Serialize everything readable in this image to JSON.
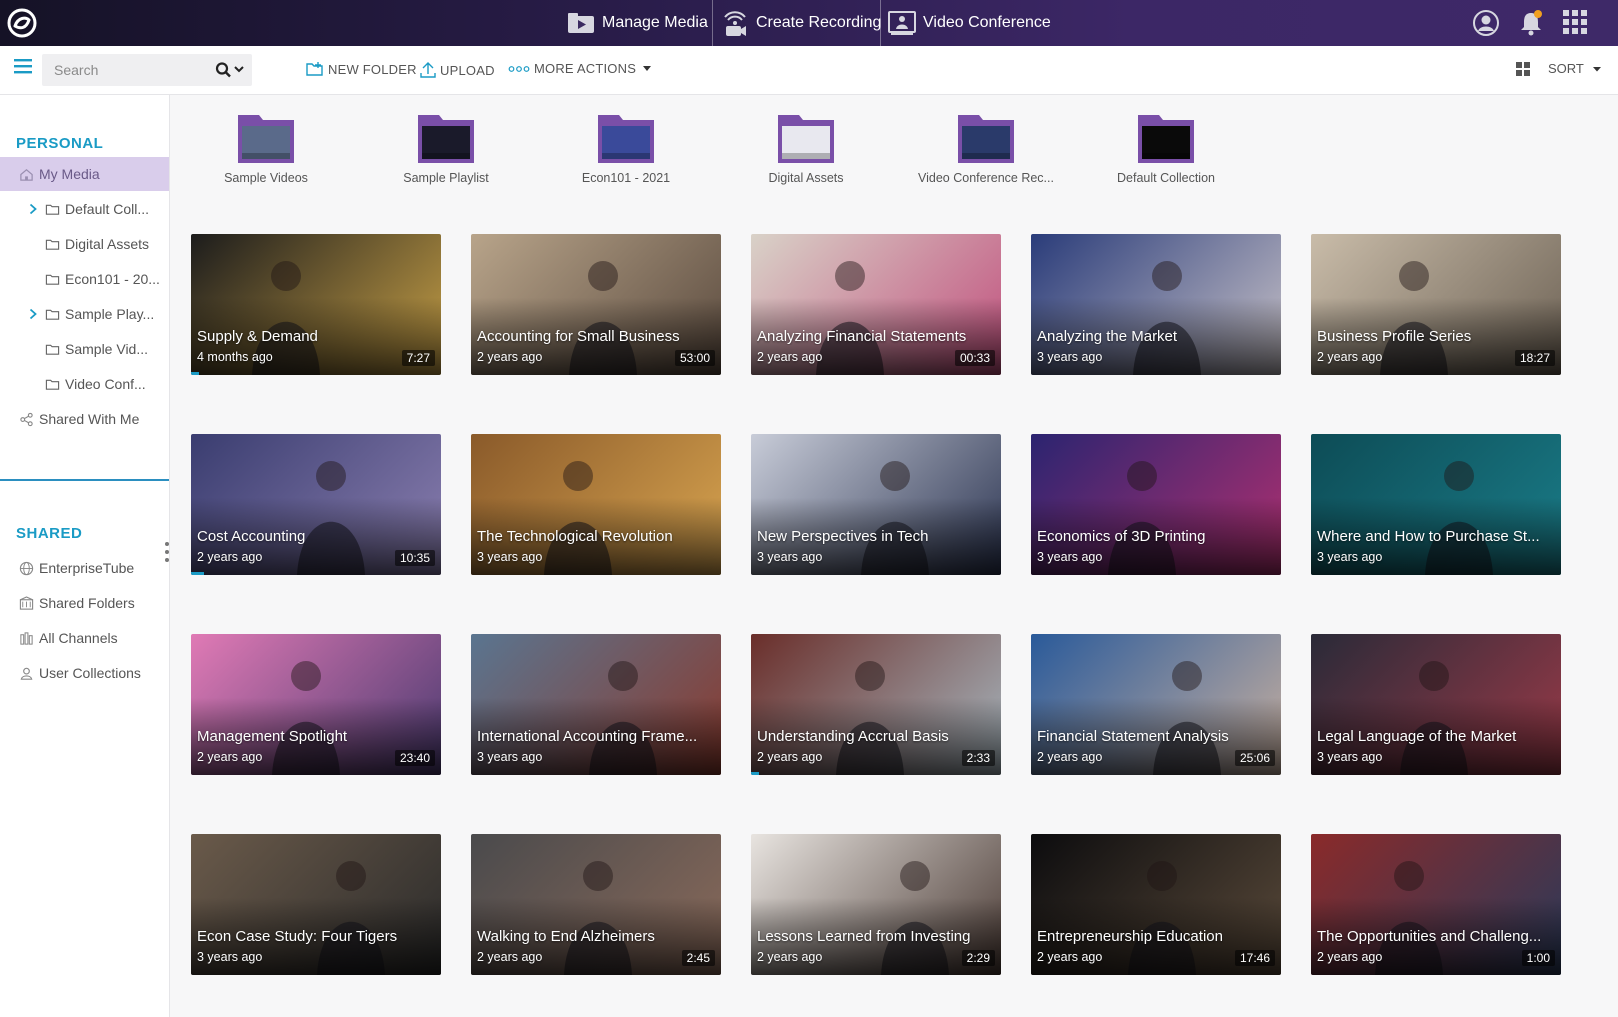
{
  "topbar": {
    "nav": [
      {
        "label": "Manage Media",
        "icon": "manage-media-icon"
      },
      {
        "label": "Create Recording",
        "icon": "create-recording-icon"
      },
      {
        "label": "Video Conference",
        "icon": "video-conference-icon"
      }
    ],
    "right_icons": [
      "user-account-icon",
      "notifications-bell-icon",
      "app-grid-icon"
    ]
  },
  "toolbar": {
    "search_placeholder": "Search",
    "new_folder": "NEW FOLDER",
    "upload": "UPLOAD",
    "more_actions": "MORE ACTIONS",
    "sort": "SORT"
  },
  "sidebar": {
    "personal_heading": "PERSONAL",
    "personal_items": [
      {
        "label": "My Media",
        "icon": "home-icon",
        "active": true,
        "expandable": false
      },
      {
        "label": "Default Coll...",
        "icon": "folder-icon",
        "expandable": true
      },
      {
        "label": "Digital Assets",
        "icon": "folder-icon",
        "expandable": false
      },
      {
        "label": "Econ101 - 20...",
        "icon": "folder-icon",
        "expandable": false
      },
      {
        "label": "Sample Play...",
        "icon": "folder-icon",
        "expandable": true
      },
      {
        "label": "Sample Vid...",
        "icon": "folder-icon",
        "expandable": false
      },
      {
        "label": "Video Conf...",
        "icon": "folder-icon",
        "expandable": false
      },
      {
        "label": "Shared With Me",
        "icon": "share-icon",
        "expandable": false
      }
    ],
    "shared_heading": "SHARED",
    "shared_items": [
      {
        "label": "EnterpriseTube",
        "icon": "globe-icon"
      },
      {
        "label": "Shared Folders",
        "icon": "shared-folders-icon"
      },
      {
        "label": "All Channels",
        "icon": "channels-icon"
      },
      {
        "label": "User Collections",
        "icon": "user-collections-icon"
      }
    ]
  },
  "folders": [
    {
      "label": "Sample Videos"
    },
    {
      "label": "Sample Playlist"
    },
    {
      "label": "Econ101 - 2021"
    },
    {
      "label": "Digital Assets"
    },
    {
      "label": "Video Conference Rec..."
    },
    {
      "label": "Default Collection"
    }
  ],
  "videos": [
    {
      "title": "Supply & Demand",
      "age": "4 months ago",
      "duration": "7:27",
      "progress": 0.03,
      "colors": [
        "#1c1c1c",
        "#c7a046"
      ]
    },
    {
      "title": "Accounting for Small Business",
      "age": "2 years ago",
      "duration": "53:00",
      "progress": 0,
      "colors": [
        "#b8a48a",
        "#5a4a3e"
      ]
    },
    {
      "title": "Analyzing Financial Statements",
      "age": "2 years ago",
      "duration": "00:33",
      "progress": 0,
      "colors": [
        "#d9d2c8",
        "#c14f7d"
      ]
    },
    {
      "title": "Analyzing the Market",
      "age": "3 years ago",
      "duration": "",
      "progress": 0,
      "colors": [
        "#2a3c7a",
        "#c8c2c8"
      ]
    },
    {
      "title": "Business Profile Series",
      "age": "2 years ago",
      "duration": "18:27",
      "progress": 0,
      "colors": [
        "#c9bca9",
        "#6c6154"
      ]
    },
    {
      "title": "Cost Accounting",
      "age": "2 years ago",
      "duration": "10:35",
      "progress": 0.05,
      "colors": [
        "#3a3d70",
        "#8b7fb0"
      ]
    },
    {
      "title": "The Technological Revolution",
      "age": "3 years ago",
      "duration": "",
      "progress": 0,
      "colors": [
        "#8a5a2a",
        "#d9a550"
      ]
    },
    {
      "title": "New Perspectives in Tech",
      "age": "3 years ago",
      "duration": "",
      "progress": 0,
      "colors": [
        "#c8ccd8",
        "#2c3552"
      ]
    },
    {
      "title": "Economics of 3D Printing",
      "age": "3 years ago",
      "duration": "",
      "progress": 0,
      "colors": [
        "#2b2470",
        "#b03070"
      ]
    },
    {
      "title": "Where and How to Purchase St...",
      "age": "3 years ago",
      "duration": "",
      "progress": 0,
      "colors": [
        "#0d4c56",
        "#1a7c88"
      ]
    },
    {
      "title": "Management Spotlight",
      "age": "2 years ago",
      "duration": "23:40",
      "progress": 0,
      "colors": [
        "#e07ab5",
        "#4a3a70"
      ]
    },
    {
      "title": "International Accounting Frame...",
      "age": "3 years ago",
      "duration": "",
      "progress": 0,
      "colors": [
        "#5a7590",
        "#8a3a2e"
      ]
    },
    {
      "title": "Understanding Accrual Basis",
      "age": "2 years ago",
      "duration": "2:33",
      "progress": 0.03,
      "colors": [
        "#6a2e2a",
        "#a8b8c0"
      ]
    },
    {
      "title": "Financial Statement Analysis",
      "age": "2 years ago",
      "duration": "25:06",
      "progress": 0,
      "colors": [
        "#2a5a9a",
        "#c8b0a0"
      ]
    },
    {
      "title": "Legal Language of the Market",
      "age": "3 years ago",
      "duration": "",
      "progress": 0,
      "colors": [
        "#2a2a38",
        "#9a3a48"
      ]
    },
    {
      "title": "Econ Case Study: Four Tigers",
      "age": "3 years ago",
      "duration": "",
      "progress": 0,
      "colors": [
        "#6a5a4a",
        "#2a2a2a"
      ]
    },
    {
      "title": "Walking to End Alzheimers",
      "age": "2 years ago",
      "duration": "2:45",
      "progress": 0,
      "colors": [
        "#4a4a4c",
        "#8a6a5a"
      ]
    },
    {
      "title": "Lessons Learned from Investing",
      "age": "2 years ago",
      "duration": "2:29",
      "progress": 0,
      "colors": [
        "#e8e4e0",
        "#4a3a34"
      ]
    },
    {
      "title": "Entrepreneurship Education",
      "age": "2 years ago",
      "duration": "17:46",
      "progress": 0,
      "colors": [
        "#0c0c0e",
        "#5a4a3a"
      ]
    },
    {
      "title": "The Opportunities and Challeng...",
      "age": "2 years ago",
      "duration": "1:00",
      "progress": 0,
      "colors": [
        "#8a2a2a",
        "#2a3a5a"
      ]
    }
  ],
  "colors": {
    "accent": "#1a9bc5",
    "active_item": "#d9cdeb",
    "folder_purple": "#7a4fa8"
  }
}
